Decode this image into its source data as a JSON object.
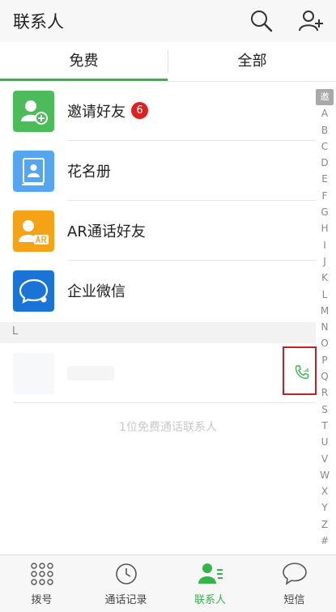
{
  "header": {
    "title": "联系人",
    "icons": [
      "search-icon",
      "add-contact-icon"
    ]
  },
  "tabs": [
    {
      "label": "免费",
      "active": true
    },
    {
      "label": "全部",
      "active": false
    }
  ],
  "rows": [
    {
      "label": "邀请好友",
      "icon": "invite-friend-icon",
      "color": "#4cbc5a",
      "badge": "6"
    },
    {
      "label": "花名册",
      "icon": "roster-book-icon",
      "color": "#55a6f0"
    },
    {
      "label": "AR通话好友",
      "icon": "ar-call-icon",
      "color": "#f4a316"
    },
    {
      "label": "企业微信",
      "icon": "wecom-icon",
      "color": "#1a73d6"
    }
  ],
  "section": {
    "letter": "L"
  },
  "footer_note": "1位免费通话联系人",
  "alphabet": [
    "邀",
    "A",
    "B",
    "C",
    "D",
    "E",
    "F",
    "G",
    "H",
    "I",
    "J",
    "K",
    "L",
    "M",
    "N",
    "O",
    "P",
    "Q",
    "R",
    "S",
    "T",
    "U",
    "V",
    "W",
    "X",
    "Y",
    "Z",
    "#"
  ],
  "bottom_tabs": [
    {
      "label": "拨号",
      "icon": "dialpad-icon"
    },
    {
      "label": "通话记录",
      "icon": "clock-icon"
    },
    {
      "label": "联系人",
      "icon": "contacts-icon",
      "active": true
    },
    {
      "label": "短信",
      "icon": "message-icon"
    }
  ],
  "colors": {
    "accent": "#35b44a",
    "badge": "#e02020",
    "highlight_box": "#c0202a"
  }
}
